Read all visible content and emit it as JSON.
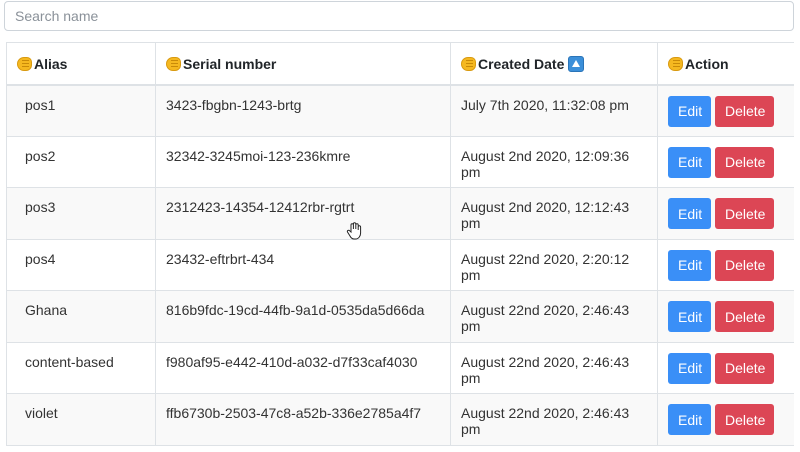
{
  "search": {
    "placeholder": "Search name",
    "value": ""
  },
  "table": {
    "headers": {
      "alias": "Alias",
      "serial": "Serial number",
      "created": "Created Date",
      "action": "Action"
    },
    "rows": [
      {
        "alias": "pos1",
        "serial": "3423-fbgbn-1243-brtg",
        "created": "July 7th 2020, 11:32:08 pm",
        "edit": "Edit",
        "delete": "Delete"
      },
      {
        "alias": "pos2",
        "serial": "32342-3245moi-123-236kmre",
        "created": "August 2nd 2020, 12:09:36 pm",
        "edit": "Edit",
        "delete": "Delete"
      },
      {
        "alias": "pos3",
        "serial": "2312423-14354-12412rbr-rgtrt",
        "created": "August 2nd 2020, 12:12:43 pm",
        "edit": "Edit",
        "delete": "Delete"
      },
      {
        "alias": "pos4",
        "serial": "23432-eftrbrt-434",
        "created": "August 22nd 2020, 2:20:12 pm",
        "edit": "Edit",
        "delete": "Delete"
      },
      {
        "alias": "Ghana",
        "serial": "816b9fdc-19cd-44fb-9a1d-0535da5d66da",
        "created": "August 22nd 2020, 2:46:43 pm",
        "edit": "Edit",
        "delete": "Delete"
      },
      {
        "alias": "content-based",
        "serial": "f980af95-e442-410d-a032-d7f33caf4030",
        "created": "August 22nd 2020, 2:46:43 pm",
        "edit": "Edit",
        "delete": "Delete"
      },
      {
        "alias": "violet",
        "serial": "ffb6730b-2503-47c8-a52b-336e2785a4f7",
        "created": "August 22nd 2020, 2:46:43 pm",
        "edit": "Edit",
        "delete": "Delete"
      }
    ]
  },
  "colors": {
    "edit": "#3a8ff7",
    "delete": "#dc4655",
    "stripe": "#f9f9f9",
    "border": "#dee2e6"
  },
  "icons": {
    "header_emoji": "fist-emoji-icon",
    "sort": "sort-ascending-icon",
    "cursor": "hand-cursor-icon"
  }
}
